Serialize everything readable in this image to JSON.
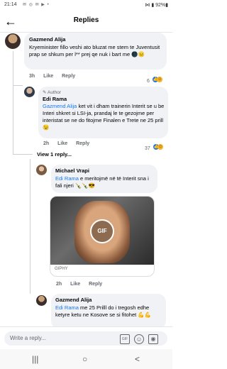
{
  "status": {
    "time": "21:14",
    "icons": "✉ ◎ ✉ ▶ •",
    "right": "⋈ ▮ 92%▮"
  },
  "header": {
    "back_icon": "←",
    "title": "Replies"
  },
  "comments": [
    {
      "name": "Gazmend Alija",
      "text": "Kryeminister fillo veshi ato bluzat me stem te Juventusit prap se shkum per l** prej qe nuk i bart me 🌑😐",
      "time": "3h",
      "like": "Like",
      "reply": "Reply",
      "count": "6"
    },
    {
      "badge": "Author",
      "name": "Edi Rama",
      "mention": "Gazmend Alija",
      "text": " ket vit i dham trainerin Interit se u be Interi shkret si LSI-ja, prandaj le te gezojme per interistat se ne do fitojme Finalen e Trete ne 25 prill😉",
      "time": "2h",
      "like": "Like",
      "reply": "Reply",
      "count": "37"
    },
    {
      "view_replies": "View 1 reply...",
      "name": "Michael Vrapi",
      "mention": "Edi Rama",
      "text": " e meritojmë në të Interit sna i fali njeri 🍾🍾😎",
      "gif_label": "GIF",
      "giphy": "GIPHY",
      "time": "2h",
      "like": "Like",
      "reply": "Reply"
    },
    {
      "name": "Gazmend Alija",
      "mention": "Edi Rama",
      "text": " me 25 Prilll do i tregosh edhe ketyre ketu ne Kosove se si fitohet 💪💪"
    }
  ],
  "composer": {
    "placeholder": "Write a reply...",
    "gif": "GIF",
    "emoji": "☺",
    "camera": "◉"
  },
  "nav": {
    "recent": "|||",
    "home": "○",
    "back": "<"
  }
}
